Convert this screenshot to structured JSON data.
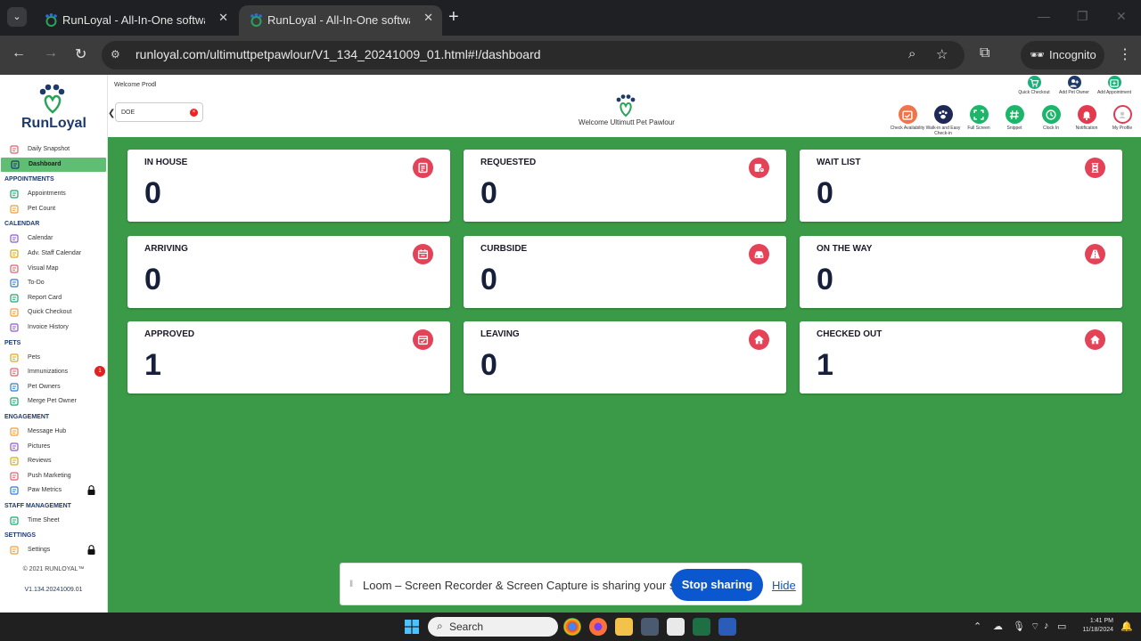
{
  "browser": {
    "tabs": [
      {
        "title": "RunLoyal - All-In-One software",
        "active": false
      },
      {
        "title": "RunLoyal - All-In-One software",
        "active": true
      }
    ],
    "url": "runloyal.com/ultimuttpetpawlour/V1_134_20241009_01.html#!/dashboard",
    "mode_label": "Incognito"
  },
  "brand": {
    "name": "RunLoyal",
    "accent": "#3a9a47",
    "navy": "#1e3a6b",
    "card_icon_color": "#e44257"
  },
  "header": {
    "welcome_small": "Welcome Prodl",
    "search_value": "DOE",
    "welcome_big": "Welcome Ultimutt Pet Pawlour",
    "quick_actions": [
      {
        "label": "Quick Checkout",
        "icon": "cart-icon",
        "color": "#19b07a"
      },
      {
        "label": "Add Pet Owner",
        "icon": "add-user-icon",
        "color": "#1e3a6b"
      },
      {
        "label": "Add Appointment",
        "icon": "add-appointment-icon",
        "color": "#19b07a"
      }
    ],
    "toolbar_buttons": [
      {
        "label": "Check Availability",
        "icon": "calendar-check-icon",
        "color": "#f0734a"
      },
      {
        "label": "Walk-in and Easy Check-in",
        "icon": "paw-icon",
        "color": "#1e2a55"
      },
      {
        "label": "Full Screen",
        "icon": "fullscreen-icon",
        "color": "#1cb56a"
      },
      {
        "label": "Snippet",
        "icon": "hash-icon",
        "color": "#1cb56a"
      },
      {
        "label": "Clock In",
        "icon": "clock-icon",
        "color": "#1cb56a"
      },
      {
        "label": "Notification",
        "icon": "bell-icon",
        "color": "#e43a50"
      },
      {
        "label": "My Profile",
        "icon": "profile-icon",
        "color": "#e43a50"
      }
    ]
  },
  "sidebar": {
    "groups": [
      {
        "section": "",
        "items": [
          {
            "label": "Daily Snapshot",
            "icon": "snapshot-icon"
          },
          {
            "label": "Dashboard",
            "icon": "dashboard-icon",
            "active": true
          }
        ]
      },
      {
        "section": "APPOINTMENTS",
        "items": [
          {
            "label": "Appointments",
            "icon": "appointments-icon"
          },
          {
            "label": "Pet Count",
            "icon": "pet-count-icon"
          }
        ]
      },
      {
        "section": "CALENDAR",
        "items": [
          {
            "label": "Calendar",
            "icon": "calendar-icon"
          },
          {
            "label": "Adv. Staff Calendar",
            "icon": "staff-calendar-icon"
          },
          {
            "label": "Visual Map",
            "icon": "map-icon"
          },
          {
            "label": "To-Do",
            "icon": "todo-icon"
          },
          {
            "label": "Report Card",
            "icon": "report-card-icon"
          },
          {
            "label": "Quick Checkout",
            "icon": "cart-icon"
          },
          {
            "label": "Invoice History",
            "icon": "invoice-icon"
          }
        ]
      },
      {
        "section": "PETS",
        "items": [
          {
            "label": "Pets",
            "icon": "pets-icon"
          },
          {
            "label": "Immunizations",
            "icon": "immunization-icon",
            "badge": "1"
          },
          {
            "label": "Pet Owners",
            "icon": "owner-icon"
          },
          {
            "label": "Merge Pet Owner",
            "icon": "merge-icon"
          }
        ]
      },
      {
        "section": "ENGAGEMENT",
        "items": [
          {
            "label": "Message Hub",
            "icon": "message-icon"
          },
          {
            "label": "Pictures",
            "icon": "pictures-icon"
          },
          {
            "label": "Reviews",
            "icon": "reviews-icon"
          },
          {
            "label": "Push Marketing",
            "icon": "push-icon"
          },
          {
            "label": "Paw Metrics",
            "icon": "metrics-icon",
            "locked": true
          }
        ]
      },
      {
        "section": "STAFF MANAGEMENT",
        "items": [
          {
            "label": "Time Sheet",
            "icon": "timesheet-icon"
          }
        ]
      },
      {
        "section": "SETTINGS",
        "items": [
          {
            "label": "Settings",
            "icon": "settings-icon",
            "locked": true
          }
        ]
      }
    ],
    "copyright": "© 2021  RUNLOYAL™",
    "version": "V1.134.20241009.01"
  },
  "cards": [
    {
      "label": "IN HOUSE",
      "value": "0",
      "icon": "checklist-icon"
    },
    {
      "label": "REQUESTED",
      "value": "0",
      "icon": "request-icon"
    },
    {
      "label": "WAIT LIST",
      "value": "0",
      "icon": "hourglass-icon"
    },
    {
      "label": "ARRIVING",
      "value": "0",
      "icon": "arrival-calendar-icon"
    },
    {
      "label": "CURBSIDE",
      "value": "0",
      "icon": "car-icon"
    },
    {
      "label": "ON THE WAY",
      "value": "0",
      "icon": "road-icon"
    },
    {
      "label": "APPROVED",
      "value": "1",
      "icon": "approved-calendar-icon"
    },
    {
      "label": "LEAVING",
      "value": "0",
      "icon": "home-icon"
    },
    {
      "label": "CHECKED OUT",
      "value": "1",
      "icon": "home-icon"
    }
  ],
  "loom": {
    "message": "Loom – Screen Recorder & Screen Capture is sharing your screen.",
    "stop_label": "Stop sharing",
    "hide_label": "Hide"
  },
  "taskbar": {
    "search_placeholder": "Search",
    "time": "1:41 PM",
    "date": "11/18/2024"
  }
}
